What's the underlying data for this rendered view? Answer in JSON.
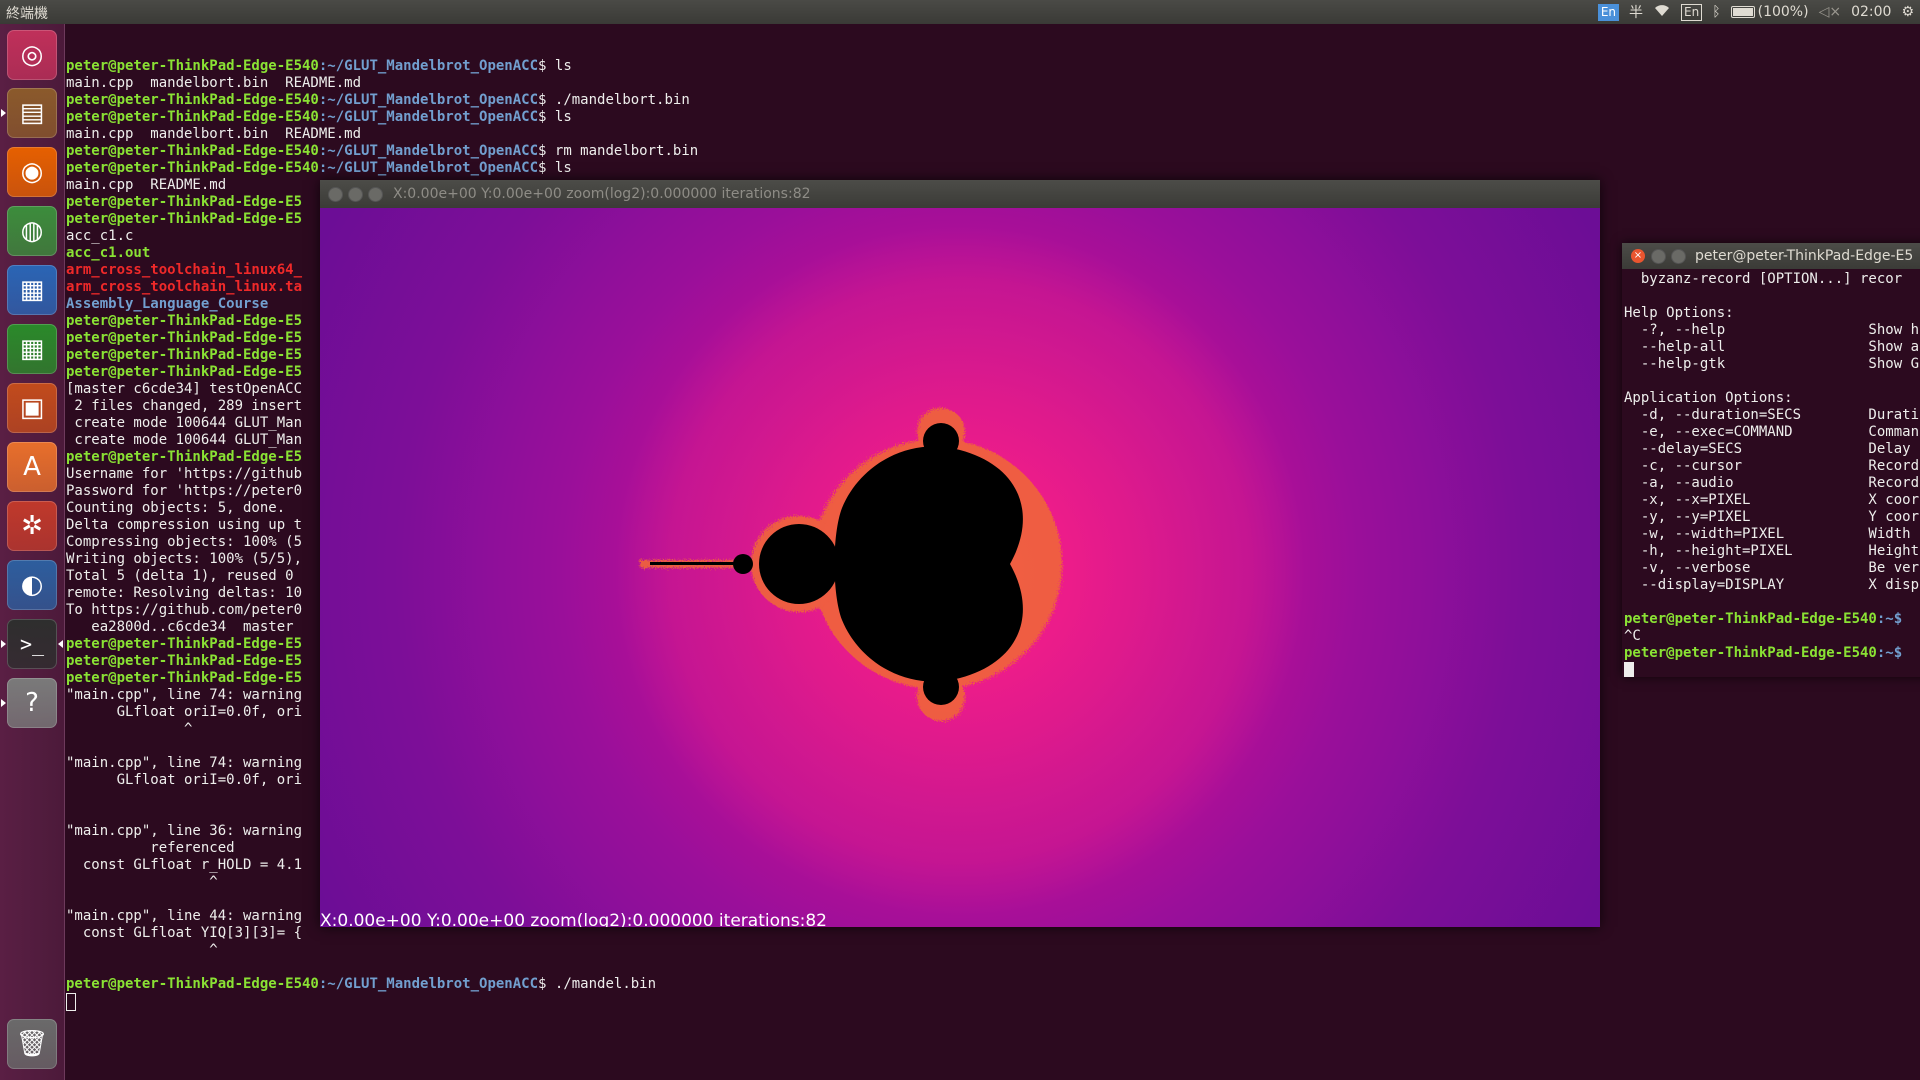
{
  "top_panel": {
    "title": "終端機",
    "tray": {
      "input_method": "En",
      "input_mode": "半",
      "keyboard_layout": "En",
      "battery": "(100%)",
      "clock": "02:00"
    }
  },
  "launcher": {
    "items": [
      {
        "name": "dash-icon",
        "glyph": "◎",
        "color": "#c0305a"
      },
      {
        "name": "files-icon",
        "glyph": "▤",
        "color": "#8b5a2b"
      },
      {
        "name": "firefox-icon",
        "glyph": "◉",
        "color": "#e66000"
      },
      {
        "name": "chrome-icon",
        "glyph": "◍",
        "color": "#3c8d3c"
      },
      {
        "name": "writer-icon",
        "glyph": "▦",
        "color": "#2a65b5"
      },
      {
        "name": "calc-icon",
        "glyph": "▦",
        "color": "#2a8a2a"
      },
      {
        "name": "impress-icon",
        "glyph": "▣",
        "color": "#c24b1c"
      },
      {
        "name": "software-center-icon",
        "glyph": "A",
        "color": "#e86f2b"
      },
      {
        "name": "system-settings-icon",
        "glyph": "✲",
        "color": "#c0392b"
      },
      {
        "name": "globe-icon",
        "glyph": "◐",
        "color": "#2d5e9e"
      },
      {
        "name": "terminal-icon",
        "glyph": ">_",
        "color": "#2e2e2e"
      },
      {
        "name": "help-icon",
        "glyph": "?",
        "color": "#7a7a7a"
      },
      {
        "name": "trash-icon",
        "glyph": "🗑",
        "color": "#6a6a6a"
      }
    ]
  },
  "terminal": {
    "prompt_user": "peter@peter-ThinkPad-Edge-E540",
    "prompt_path": ":~/GLUT_Mandelbrot_OpenACC",
    "prompt_user_trunc": "peter@peter-ThinkPad-Edge-E5",
    "lines": [
      {
        "type": "prompt",
        "cmd": "$ ls"
      },
      {
        "type": "text",
        "text": "main.cpp  mandelbort.bin  README.md"
      },
      {
        "type": "prompt",
        "cmd": "$ ./mandelbort.bin"
      },
      {
        "type": "prompt",
        "cmd": "$ ls"
      },
      {
        "type": "text",
        "text": "main.cpp  mandelbort.bin  README.md"
      },
      {
        "type": "prompt",
        "cmd": "$ rm mandelbort.bin"
      },
      {
        "type": "prompt",
        "cmd": "$ ls"
      },
      {
        "type": "text",
        "text": "main.cpp  README.md"
      },
      {
        "type": "ptrunc"
      },
      {
        "type": "ptrunc"
      },
      {
        "type": "text",
        "text": "acc_c1.c"
      },
      {
        "type": "grn",
        "text": "acc_c1.out"
      },
      {
        "type": "red",
        "text": "arm_cross_toolchain_linux64_"
      },
      {
        "type": "red",
        "text": "arm_cross_toolchain_linux.ta"
      },
      {
        "type": "blue",
        "text": "Assembly_Language_Course"
      },
      {
        "type": "ptrunc"
      },
      {
        "type": "ptrunc"
      },
      {
        "type": "ptrunc"
      },
      {
        "type": "ptrunc"
      },
      {
        "type": "text",
        "text": "[master c6cde34] testOpenACC"
      },
      {
        "type": "text",
        "text": " 2 files changed, 289 insert"
      },
      {
        "type": "text",
        "text": " create mode 100644 GLUT_Man"
      },
      {
        "type": "text",
        "text": " create mode 100644 GLUT_Man"
      },
      {
        "type": "ptrunc"
      },
      {
        "type": "text",
        "text": "Username for 'https://github"
      },
      {
        "type": "text",
        "text": "Password for 'https://peter0"
      },
      {
        "type": "text",
        "text": "Counting objects: 5, done."
      },
      {
        "type": "text",
        "text": "Delta compression using up t"
      },
      {
        "type": "text",
        "text": "Compressing objects: 100% (5"
      },
      {
        "type": "text",
        "text": "Writing objects: 100% (5/5),"
      },
      {
        "type": "text",
        "text": "Total 5 (delta 1), reused 0"
      },
      {
        "type": "text",
        "text": "remote: Resolving deltas: 10"
      },
      {
        "type": "text",
        "text": "To https://github.com/peter0"
      },
      {
        "type": "text",
        "text": "   ea2800d..c6cde34  master"
      },
      {
        "type": "ptrunc"
      },
      {
        "type": "ptrunc"
      },
      {
        "type": "ptrunc"
      },
      {
        "type": "text",
        "text": "\"main.cpp\", line 74: warning"
      },
      {
        "type": "text",
        "text": "      GLfloat oriI=0.0f, ori"
      },
      {
        "type": "text",
        "text": "              ^"
      },
      {
        "type": "text",
        "text": ""
      },
      {
        "type": "text",
        "text": "\"main.cpp\", line 74: warning"
      },
      {
        "type": "text",
        "text": "      GLfloat oriI=0.0f, ori"
      },
      {
        "type": "text",
        "text": ""
      },
      {
        "type": "text",
        "text": ""
      },
      {
        "type": "text",
        "text": "\"main.cpp\", line 36: warning"
      },
      {
        "type": "text",
        "text": "          referenced"
      },
      {
        "type": "text",
        "text": "  const GLfloat r_HOLD = 4.1"
      },
      {
        "type": "text",
        "text": "                 ^"
      },
      {
        "type": "text",
        "text": ""
      },
      {
        "type": "text",
        "text": "\"main.cpp\", line 44: warning"
      },
      {
        "type": "text",
        "text": "  const GLfloat YIQ[3][3]= {"
      },
      {
        "type": "text",
        "text": "                 ^"
      },
      {
        "type": "text",
        "text": ""
      },
      {
        "type": "prompt",
        "cmd": "$ ./mandel.bin"
      },
      {
        "type": "cursor"
      }
    ]
  },
  "gl_window": {
    "title": "X:0.00e+00 Y:0.00e+00 zoom(log2):0.000000 iterations:82",
    "overlay": "X:0.00e+00 Y:0.00e+00 zoom(log2):0.000000 iterations:82"
  },
  "right_terminal": {
    "title": "peter@peter-ThinkPad-Edge-E5",
    "lines": [
      {
        "type": "text",
        "text": "  byzanz-record [OPTION...] recor"
      },
      {
        "type": "text",
        "text": ""
      },
      {
        "type": "text",
        "text": "Help Options:"
      },
      {
        "type": "text",
        "text": "  -?, --help                 Show h"
      },
      {
        "type": "text",
        "text": "  --help-all                 Show a"
      },
      {
        "type": "text",
        "text": "  --help-gtk                 Show G"
      },
      {
        "type": "text",
        "text": ""
      },
      {
        "type": "text",
        "text": "Application Options:"
      },
      {
        "type": "text",
        "text": "  -d, --duration=SECS        Durati"
      },
      {
        "type": "text",
        "text": "  -e, --exec=COMMAND         Comman"
      },
      {
        "type": "text",
        "text": "  --delay=SECS               Delay"
      },
      {
        "type": "text",
        "text": "  -c, --cursor               Record"
      },
      {
        "type": "text",
        "text": "  -a, --audio                Record"
      },
      {
        "type": "text",
        "text": "  -x, --x=PIXEL              X coor"
      },
      {
        "type": "text",
        "text": "  -y, --y=PIXEL              Y coor"
      },
      {
        "type": "text",
        "text": "  -w, --width=PIXEL          Width"
      },
      {
        "type": "text",
        "text": "  -h, --height=PIXEL         Height"
      },
      {
        "type": "text",
        "text": "  -v, --verbose              Be ver"
      },
      {
        "type": "text",
        "text": "  --display=DISPLAY          X disp"
      },
      {
        "type": "text",
        "text": ""
      },
      {
        "type": "rprompt",
        "text": ":~$"
      },
      {
        "type": "text",
        "text": "^C"
      },
      {
        "type": "rprompt",
        "text": ":~$"
      },
      {
        "type": "cursor"
      }
    ]
  }
}
